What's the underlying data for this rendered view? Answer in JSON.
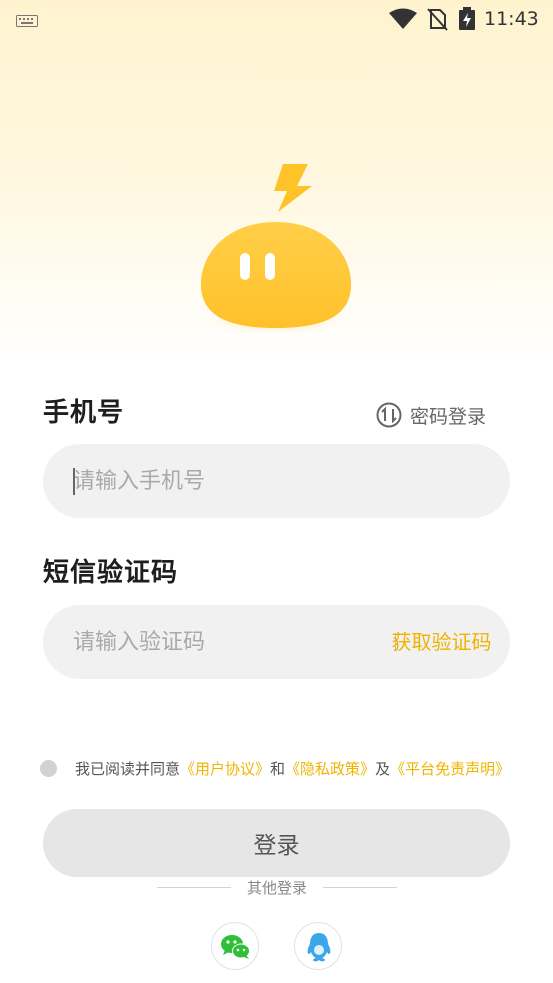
{
  "status_bar": {
    "time": "11:43",
    "icons": [
      "keyboard-icon",
      "wifi-icon",
      "no-sim-icon",
      "battery-charging-icon"
    ]
  },
  "form": {
    "phone_label": "手机号",
    "switch_login_label": "密码登录",
    "phone_placeholder": "请输入手机号",
    "phone_value": "",
    "code_label": "短信验证码",
    "code_placeholder": "请输入验证码",
    "code_value": "",
    "get_code_label": "获取验证码"
  },
  "agreement": {
    "checked": false,
    "prefix": "我已阅读并同意",
    "user_agreement": "《用户协议》",
    "and": "和",
    "privacy_policy": "《隐私政策》",
    "also": "及",
    "disclaimer": "《平台免责声明》"
  },
  "login_button_label": "登录",
  "other_login": {
    "label": "其他登录",
    "options": [
      "wechat-icon",
      "qq-icon"
    ]
  },
  "colors": {
    "accent": "#f0b400",
    "mascot": "#ffc83a",
    "field_bg": "#f1f1f1",
    "button_bg": "#e6e6e6"
  }
}
